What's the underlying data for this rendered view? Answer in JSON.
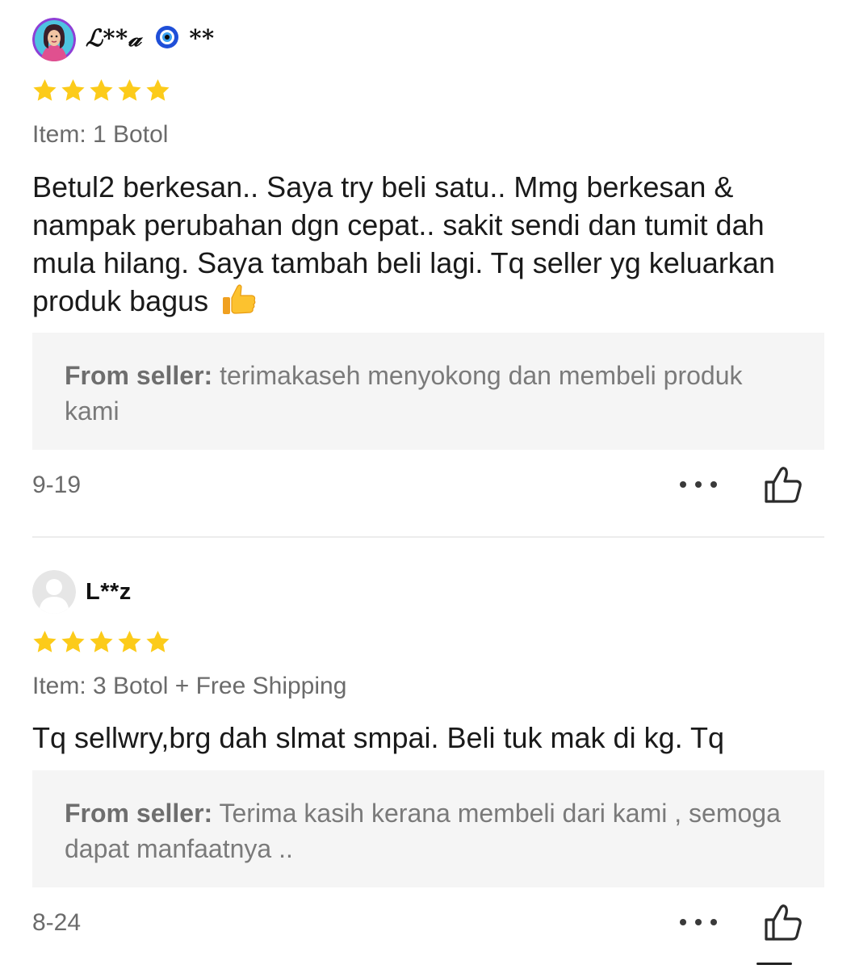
{
  "reviews": [
    {
      "username_prefix": "ℒ**𝒶",
      "username_suffix": "**",
      "avatar": "user-photo-avatar",
      "rating": 5,
      "item": "Item: 1 Botol",
      "comment": "Betul2 berkesan.. Saya try beli satu.. Mmg berkesan & nampak perubahan dgn cepat.. sakit sendi dan tumit dah mula hilang. Saya tambah beli lagi. Tq seller yg keluarkan produk bagus",
      "comment_emoji": "thumbs-up-emoji",
      "seller_prefix": "From seller:",
      "seller_reply": " terimakaseh menyokong dan membeli produk kami",
      "date": "9-19"
    },
    {
      "username": "L**z",
      "avatar": "default-avatar",
      "rating": 5,
      "item": "Item: 3 Botol + Free Shipping",
      "comment": "Tq sellwry,brg dah slmat smpai. Beli tuk mak di kg. Tq",
      "seller_prefix": "From seller:",
      "seller_reply": " Terima kasih kerana membeli dari kami , semoga dapat manfaatnya ..",
      "date": "8-24"
    }
  ],
  "colors": {
    "star": "#FCCB1A",
    "seller_box_bg": "#F5F5F5",
    "muted_text": "#6B6B6B",
    "primary_text": "#1A1A1A"
  },
  "icons": [
    "star-icon",
    "more-dots-icon",
    "thumbs-up-outline-icon",
    "evil-eye-emoji",
    "thumbs-up-emoji"
  ]
}
